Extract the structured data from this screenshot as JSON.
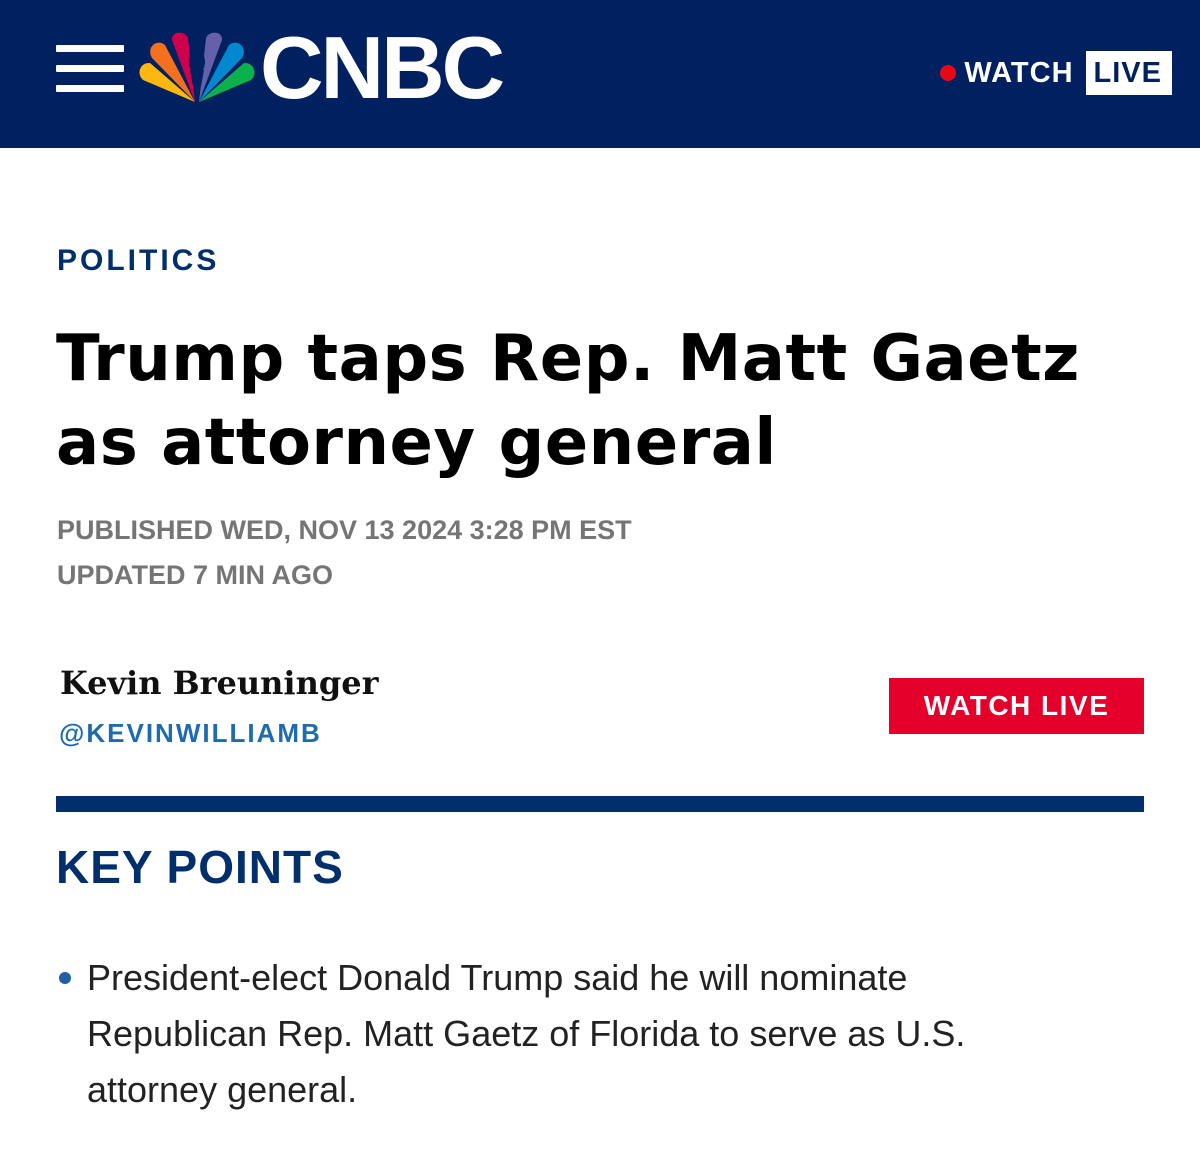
{
  "header": {
    "menu_icon": "hamburger-menu-icon",
    "logo_icon": "nbc-peacock-icon",
    "logo_text": "CNBC",
    "watch_label": "WATCH",
    "live_label": "LIVE",
    "live_dot_icon": "live-dot-icon",
    "background_color": "#002060"
  },
  "article": {
    "section": "POLITICS",
    "headline": "Trump taps Rep. Matt Gaetz as attorney general",
    "published": "PUBLISHED WED, NOV 13 2024 3:28 PM EST",
    "updated": "UPDATED 7 MIN AGO",
    "author": {
      "name": "Kevin Breuninger",
      "handle": "@KEVINWILLIAMB"
    },
    "watch_live_button": "WATCH LIVE",
    "key_points_title": "KEY POINTS",
    "key_points": [
      "President-elect Donald Trump said he will nominate Republican Rep. Matt Gaetz of Florida to serve as U.S. attorney general."
    ]
  },
  "colors": {
    "navy": "#002060",
    "accent_blue": "#002f6c",
    "link_blue": "#1f6bb0",
    "red": "#e4002b",
    "meta_gray": "#757575"
  }
}
